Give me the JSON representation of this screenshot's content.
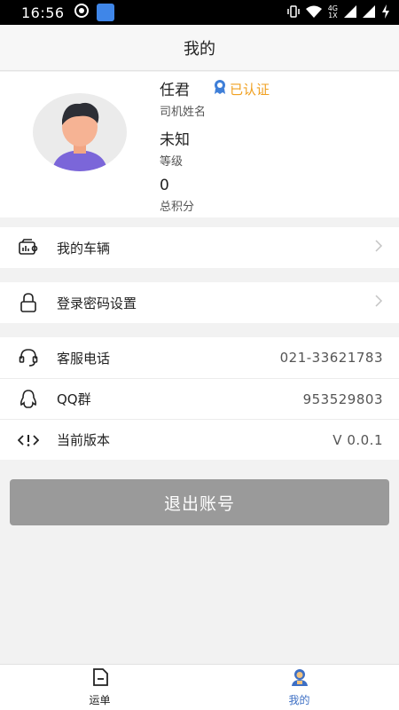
{
  "status_bar": {
    "time": "16:56",
    "network": "4G\n1X"
  },
  "header": {
    "title": "我的"
  },
  "profile": {
    "name": "任君",
    "name_label": "司机姓名",
    "verified": "已认证",
    "level": "未知",
    "level_label": "等级",
    "points": "0",
    "points_label": "总积分"
  },
  "menu": {
    "vehicle": "我的车辆",
    "password": "登录密码设置"
  },
  "info": {
    "service_label": "客服电话",
    "service_value": "021-33621783",
    "qq_label": "QQ群",
    "qq_value": "953529803",
    "version_label": "当前版本",
    "version_value": "V 0.0.1"
  },
  "logout_label": "退出账号",
  "tabs": [
    {
      "label": "运单"
    },
    {
      "label": "我的"
    }
  ],
  "colors": {
    "accent": "#3d6fc4",
    "verified": "#f0a020",
    "logout_bg": "#9a9a9a"
  }
}
